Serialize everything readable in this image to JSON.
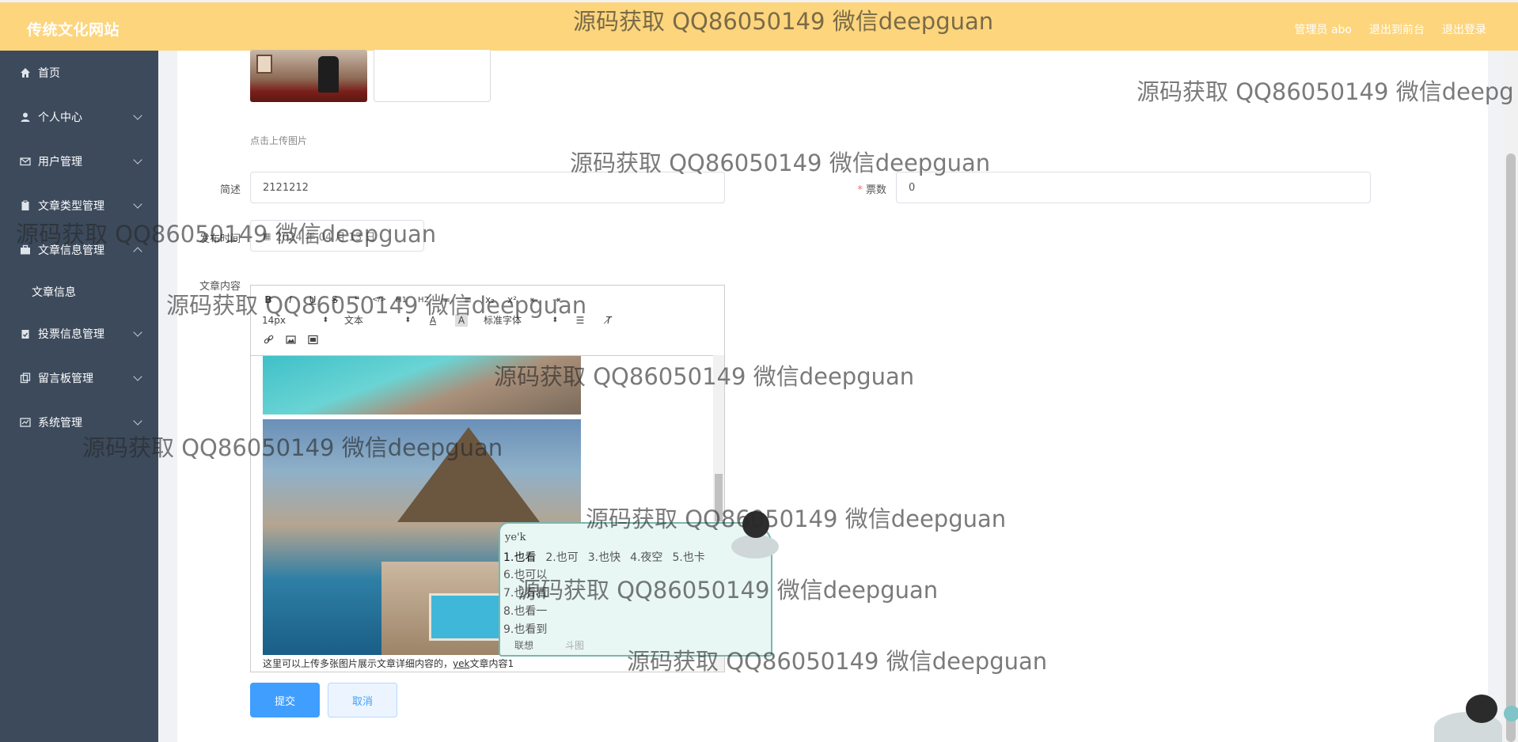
{
  "header": {
    "brand": "传统文化网站",
    "links": [
      "管理员 abo",
      "退出到前台",
      "退出登录"
    ]
  },
  "sidebar": {
    "items": [
      {
        "label": "首页",
        "icon": "home-icon",
        "has_arrow": false
      },
      {
        "label": "个人中心",
        "icon": "user-icon",
        "has_arrow": true
      },
      {
        "label": "用户管理",
        "icon": "mail-icon",
        "has_arrow": true
      },
      {
        "label": "文章类型管理",
        "icon": "clipboard-icon",
        "has_arrow": true
      },
      {
        "label": "文章信息管理",
        "icon": "briefcase-icon",
        "has_arrow": true,
        "expanded": true
      },
      {
        "label": "投票信息管理",
        "icon": "clipboard-check-icon",
        "has_arrow": true
      },
      {
        "label": "留言板管理",
        "icon": "copy-icon",
        "has_arrow": true
      },
      {
        "label": "系统管理",
        "icon": "chart-icon",
        "has_arrow": true
      }
    ],
    "submenu": {
      "label": "文章信息"
    }
  },
  "form": {
    "upload_hint": "点击上传图片",
    "summary_label": "简述",
    "summary_value": "2121212",
    "votes_label": "票数",
    "votes_value": "0",
    "publish_label": "发布时间",
    "publish_value": "2024 年 04 月 13 日",
    "content_label": "文章内容"
  },
  "editor": {
    "toolbar_row1": [
      "B",
      "I",
      "U",
      "S",
      "❝",
      "</>",
      "H1",
      "H2",
      "≔",
      "≡",
      "x₂",
      "x²",
      "⇤",
      "⇥"
    ],
    "font_size": "14px",
    "block_type": "文本",
    "font_family": "标准字体",
    "text_before": "这里可以上传多张图片展示文章详细内容的，",
    "text_typing": "yek",
    "text_after": "文章内容1"
  },
  "ime": {
    "pinyin": "ye'k",
    "candidates_row": [
      "1.也看",
      "2.也可",
      "3.也快",
      "4.夜空",
      "5.也卡"
    ],
    "candidates_more": [
      "6.也可以",
      "7.也看看",
      "8.也看一",
      "9.也看到"
    ],
    "tabs": [
      "联想",
      "斗图"
    ]
  },
  "buttons": {
    "submit": "提交",
    "cancel": "取消"
  },
  "watermarks": [
    "源码获取 QQ86050149 微信deepguan",
    "源码获取 QQ86050149 微信deepg",
    "源码获取 QQ86050149 微信deepguan",
    "源码获取 QQ86050149 微信deepguan",
    "源码获取 QQ86050149 微信deepguan",
    "源码获取 QQ86050149 微信deepguan",
    "源码获取 QQ86050149 微信deepguan",
    "源码获取 QQ86050149 微信deepguan",
    "源码获取 QQ86050149 微信deepguan",
    "源码获取 QQ86050149 微信deepguan"
  ]
}
